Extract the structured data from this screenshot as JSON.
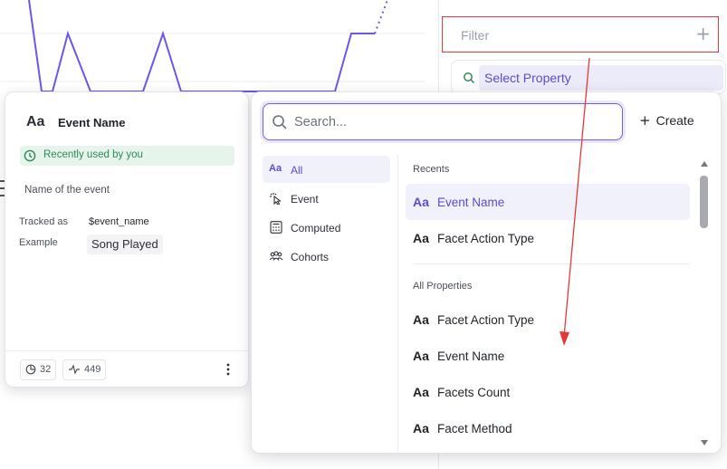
{
  "colors": {
    "accent": "#5b4bd6",
    "accent_bg": "#f1f1fb",
    "chart_line": "#6b57e8",
    "annotation": "#e53935",
    "recent_green": "#2e8b57",
    "recent_bg": "#e6f4ec"
  },
  "filter": {
    "label": "Filter",
    "add_icon": "plus-icon"
  },
  "select_property": {
    "label": "Select Property",
    "icon": "search-icon"
  },
  "detail_card": {
    "type_icon": "Aa",
    "title": "Event Name",
    "recent_badge": "Recently used by you",
    "description": "Name of the event",
    "tracked_as_label": "Tracked as",
    "tracked_as_value": "$event_name",
    "example_label": "Example",
    "example_value": "Song Played",
    "stat_reports": "32",
    "stat_events": "449"
  },
  "picker": {
    "search_placeholder": "Search...",
    "create_label": "Create",
    "nav": [
      {
        "icon": "Aa",
        "label": "All",
        "active": true
      },
      {
        "icon": "cursor-click-icon",
        "label": "Event",
        "active": false
      },
      {
        "icon": "calculator-icon",
        "label": "Computed",
        "active": false
      },
      {
        "icon": "people-icon",
        "label": "Cohorts",
        "active": false
      }
    ],
    "recents_heading": "Recents",
    "recents": [
      {
        "icon": "Aa",
        "label": "Event Name",
        "selected": true
      },
      {
        "icon": "Aa",
        "label": "Facet Action Type",
        "selected": false
      }
    ],
    "all_heading": "All Properties",
    "all_properties": [
      {
        "icon": "Aa",
        "label": "Facet Action Type"
      },
      {
        "icon": "Aa",
        "label": "Event Name"
      },
      {
        "icon": "Aa",
        "label": "Facets Count"
      },
      {
        "icon": "Aa",
        "label": "Facet Method"
      }
    ]
  }
}
